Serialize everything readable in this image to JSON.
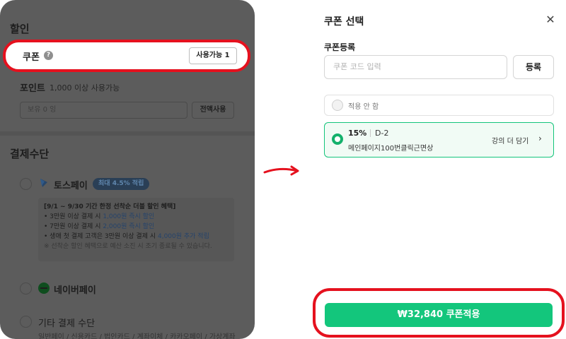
{
  "left": {
    "discount_title": "할인",
    "coupon": {
      "label": "쿠폰",
      "help_glyph": "?",
      "available_button": "사용가능 1"
    },
    "point": {
      "label": "포인트",
      "desc": "1,000 이상 사용가능",
      "input_placeholder": "보유 0 잉",
      "use_all_button": "전액사용"
    },
    "payment_title": "결제수단",
    "toss": {
      "label": "토스페이",
      "badge": "최대 4.5% 적립",
      "promo": {
        "head": "[9/1 ~ 9/30 기간 한정 선착순 더블 할인 혜택]",
        "line1_prefix": "• 3만원 이상 결제 시 ",
        "line1_highlight": "1,000원 즉시 할인",
        "line2_prefix": "• 7만원 이상 결제 시 ",
        "line2_highlight": "2,000원 즉시 할인",
        "line3_prefix": "• 생애 첫 결제 고객은 3만원 이상 결제 시 ",
        "line3_highlight": "4,000원 추가 적립",
        "note": "※ 선착순 할인 혜택으로 예산 소진 시 조기 종료될 수 있습니다."
      }
    },
    "naver": {
      "label": "네이버페이"
    },
    "etc": {
      "label": "기타 결제 수단",
      "sub": "일반페이 / 신용카드 / 법인카드 / 계좌이체 / 카카오페이 / 가상계좌"
    }
  },
  "right": {
    "title": "쿠폰 선택",
    "close_glyph": "✕",
    "register_label": "쿠폰등록",
    "code_placeholder": "쿠폰 코드 입력",
    "register_button": "등록",
    "option_none": "적용 안 함",
    "coupon_option": {
      "percent": "15%",
      "dday": "D-2",
      "name": "메인페이지100번클릭근면상",
      "more_link": "강의 더 담기",
      "chevron": "›"
    },
    "apply_button": "₩32,840 쿠폰적용"
  },
  "colors": {
    "highlight_red": "#e5111e",
    "accent_green": "#13c67c",
    "overlay": "#5c5c5c"
  }
}
